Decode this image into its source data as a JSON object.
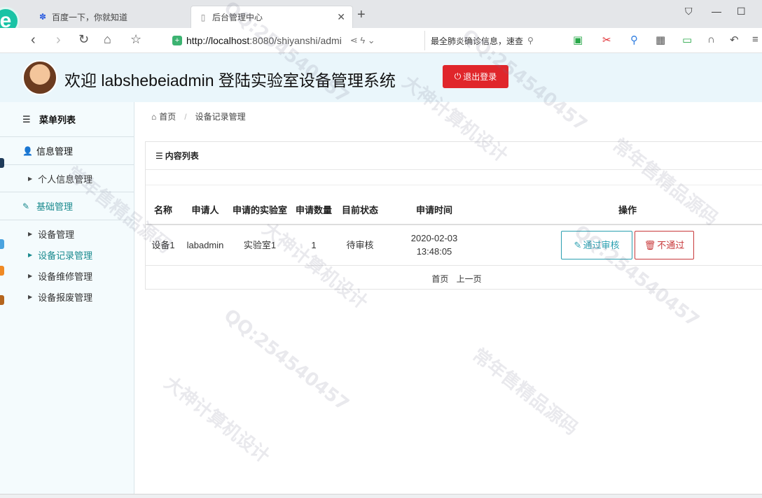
{
  "browser": {
    "tabs": [
      {
        "title": "百度一下，你就知道",
        "active": false
      },
      {
        "title": "后台管理中心",
        "active": true
      }
    ],
    "url_host": "http://localhost",
    "url_rest": ":8080/shiyanshi/admi",
    "search_hint": "最全肺炎确诊信息，速查"
  },
  "header": {
    "title": "欢迎 labshebeiadmin 登陆实验室设备管理系统",
    "logout_label": "退出登录"
  },
  "sidebar": {
    "heading": "菜单列表",
    "groups": [
      {
        "label": "信息管理",
        "items": [
          "个人信息管理"
        ]
      },
      {
        "label": "基础管理",
        "items": [
          "设备管理",
          "设备记录管理",
          "设备维修管理",
          "设备报废管理"
        ],
        "active_item": "设备记录管理"
      }
    ]
  },
  "breadcrumb": {
    "home": "首页",
    "current": "设备记录管理"
  },
  "panel": {
    "title": "内容列表"
  },
  "table": {
    "columns": [
      "名称",
      "申请人",
      "申请的实验室",
      "申请数量",
      "目前状态",
      "申请时间",
      "操作"
    ],
    "rows": [
      {
        "name": "设备1",
        "applicant": "labadmin",
        "lab": "实验室1",
        "quantity": "1",
        "status": "待审核",
        "time": "2020-02-03 13:48:05",
        "approve": "通过审核",
        "reject": "不通过"
      }
    ]
  },
  "pager": {
    "first": "首页",
    "prev": "上一页"
  },
  "watermark": [
    "QQ:254540457",
    "大神计算机设计",
    "常年售精品源码"
  ],
  "colors": {
    "accent": "#1a8a8e",
    "danger": "#e0262b",
    "header_bg": "#eaf6fb"
  }
}
